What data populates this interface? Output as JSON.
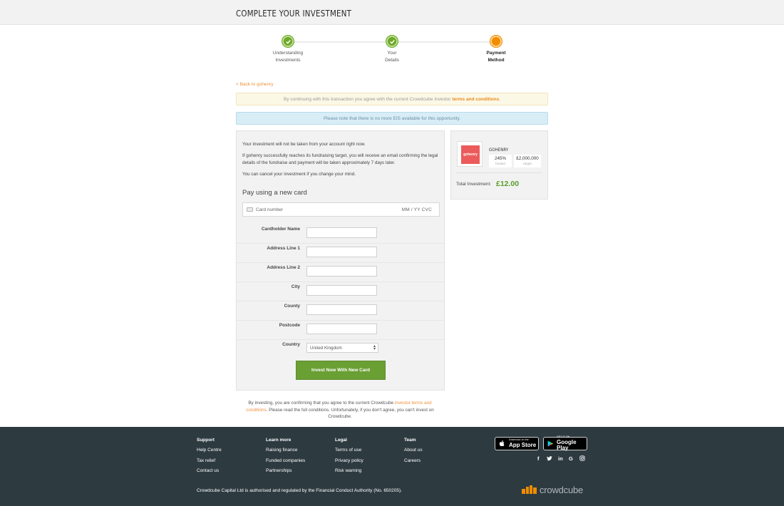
{
  "header": {
    "title": "COMPLETE YOUR INVESTMENT"
  },
  "steps": [
    {
      "label_1": "Understanding",
      "label_2": "Investments",
      "state": "done"
    },
    {
      "label_1": "Your",
      "label_2": "Details",
      "state": "done"
    },
    {
      "label_1": "Payment",
      "label_2": "Method",
      "state": "active"
    }
  ],
  "back_link": "< Back to gohenry",
  "notices": {
    "terms_text": "By continuing with this transaction you agree with the current Crowdcube Investor",
    "terms_link": "terms and conditions",
    "terms_end": ".",
    "eis_text": "Please note that there is no more EIS available for this opportunity."
  },
  "info": {
    "p1": "Your investment will not be taken from your account right now.",
    "p2": "If gohenry successfully reaches its fundraising target, you will receive an email confirming the legal details of the fundraise and payment will be taken approximately 7 days later.",
    "p3": "You can cancel your investment if you change your mind."
  },
  "payment": {
    "title": "Pay using a new card",
    "card_number_placeholder": "Card number",
    "card_expiry_cvc": "MM / YY  CVC"
  },
  "form": {
    "cardholder": "Cardholder Name",
    "address1": "Address Line 1",
    "address2": "Address Line 2",
    "city": "City",
    "county": "County",
    "postcode": "Postcode",
    "country": "Country",
    "country_value": "United Kingdom",
    "submit": "Invest Now With New Card"
  },
  "company": {
    "logo_text": "gohenry",
    "name": "GOHENRY",
    "funded_value": "245%",
    "funded_label": "funded",
    "target_value": "£2,000,000",
    "target_label": "target",
    "total_label": "Total Investment:",
    "total_value": "£12.00"
  },
  "disclaimer": {
    "text1": "By investing, you are confirming that you agree to the current Crowdcube",
    "link": "investor terms and conditions",
    "text2": ". Please read the full conditions. Unfortunately, if you don't agree, you can't invest on Crowdcube."
  },
  "footer": {
    "support": {
      "title": "Support",
      "items": [
        "Help Centre",
        "Tax relief",
        "Contact us"
      ]
    },
    "learn": {
      "title": "Learn more",
      "items": [
        "Raising finance",
        "Funded companies",
        "Partnerships"
      ]
    },
    "legal": {
      "title": "Legal",
      "items": [
        "Terms of use",
        "Privacy policy",
        "Risk warning"
      ]
    },
    "team": {
      "title": "Team",
      "items": [
        "About us",
        "Careers"
      ]
    },
    "app_store_small": "Download on the",
    "app_store_big": "App Store",
    "google_play_small": "GET IT ON",
    "google_play_big": "Google Play",
    "social_icons": [
      "facebook-icon",
      "twitter-icon",
      "linkedin-icon",
      "google-icon",
      "instagram-icon"
    ],
    "legal_text": "Crowdcube Capital Ltd is authorised and regulated by the Financial Conduct Authority (No. 650205).",
    "brand": "crowdcube"
  },
  "colors": {
    "accent_orange": "#f08c00",
    "success_green": "#6fa82a",
    "button_green": "#6a9f34",
    "footer_bg": "#2d3a40",
    "logo_red": "#ec5b5b"
  }
}
